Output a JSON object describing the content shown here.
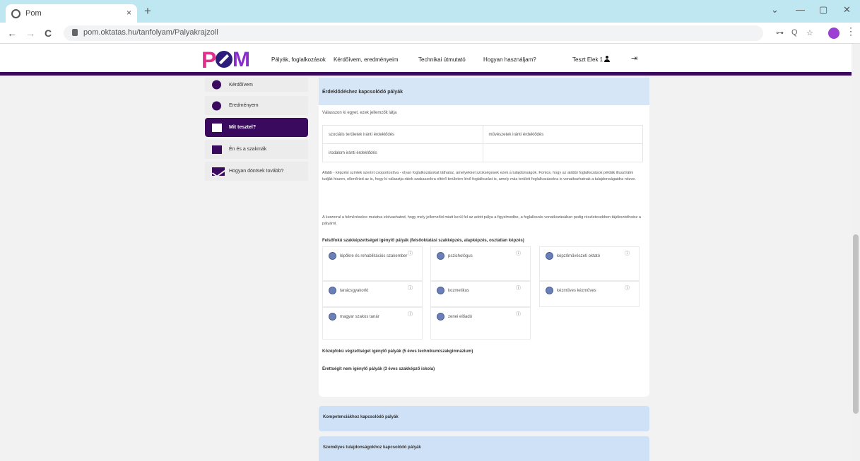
{
  "browser": {
    "tab_title": "Pom",
    "tab_close": "×",
    "new_tab": "+",
    "url": "pom.oktatas.hu/tanfolyam/Palyakrajzoll",
    "nav": {
      "back": "←",
      "forward": "→",
      "reload": "C"
    },
    "window_controls": {
      "collapse": "⌄",
      "minimize": "—",
      "restore": "▢",
      "close": "✕"
    },
    "extensions": [
      "⊶",
      "Q",
      "☆"
    ],
    "menu": "⋮"
  },
  "header": {
    "logo_text": {
      "p": "P",
      "m": "M"
    },
    "nav_items": [
      "Pályák, foglalkozások",
      "Kérdőívem, eredményeim",
      "Technikai útmutató",
      "Hogyan használjam?"
    ],
    "user_name": "Teszt Elek 1",
    "logout_icon": "⇥"
  },
  "sidebar": {
    "items": [
      {
        "label": "Kérdőívem",
        "icon": "circle-icon"
      },
      {
        "label": "Eredményem",
        "icon": "circle-icon"
      },
      {
        "label": "Mit tesztel?",
        "icon": "card-icon",
        "active": true
      },
      {
        "label": "Én és a szakmák",
        "icon": "people-icon"
      },
      {
        "label": "Hogyan döntsek tovább?",
        "icon": "mail-icon"
      }
    ]
  },
  "main": {
    "card_title": "Érdeklődéshez kapcsolódó pályák",
    "choose_text": "Válasszon ki egyet, ezek jellemzőit látja",
    "options": [
      [
        "szociális területek iránti érdeklődés",
        "művészetek iránti érdeklődés"
      ],
      [
        "irodalom iránti érdeklődés",
        ""
      ]
    ],
    "para1": "Alább - képzési szintek szerint csoportosítva - olyan foglalkozásokat láthatsz, amelyekkel szükségesek ezek a tulajdonságok. Fontos, hogy az alábbi foglalkozások példák illusztrálni tudják hiszen, ellenőrizd az is, hogy ki választja rátok szakaszokra eltérő területen lévő foglalkozást is, amely más területi foglalkozásokra is vonatkozhatnak a tulajdonságaidra nézve.",
    "para2": "A kurzorral a felmérésekre mutatva elolvashatod, hogy mely jellemzőid miatt kerül fel az adott pálya a figyelmedbe, a foglalkozás vonatkozásában pedig részletesebben tájékozódhatsz a pályáról.",
    "section_higher": "Felsőfokú szakképzettséget igénylő pályák (felsőoktatási szakképzés, alapképzés, osztatlan képzés)",
    "jobs": [
      {
        "label": "lépőkre és rehabilitációs szakember",
        "icon": "globe-icon",
        "info": "ⓘ"
      },
      {
        "label": "pszichológus",
        "icon": "globe-icon",
        "info": "ⓘ"
      },
      {
        "label": "képzőművészeti oktató",
        "icon": "globe-icon",
        "info": "ⓘ"
      },
      {
        "label": "tanácsgyakorló",
        "icon": "globe-icon",
        "info": "ⓘ"
      },
      {
        "label": "kozmetikus",
        "icon": "globe-icon",
        "info": "ⓘ"
      },
      {
        "label": "kézműves kézműves",
        "icon": "globe-icon",
        "info": "ⓘ"
      },
      {
        "label": "magyar szakos tanár",
        "icon": "globe-icon",
        "info": "ⓘ"
      },
      {
        "label": "zenei előadó",
        "icon": "globe-icon",
        "info": "ⓘ"
      }
    ],
    "section_middle": "Középfokú végzettséget igénylő pályák (5 éves technikum/szakgimnázium)",
    "section_basic": "Érettségit nem igénylő pályák (3 éves szakképző iskola)"
  },
  "bands": [
    "Kompetenciákhoz kapcsolódó pályák",
    "Személyes tulajdonságokhoz kapcsolódó pályák"
  ]
}
